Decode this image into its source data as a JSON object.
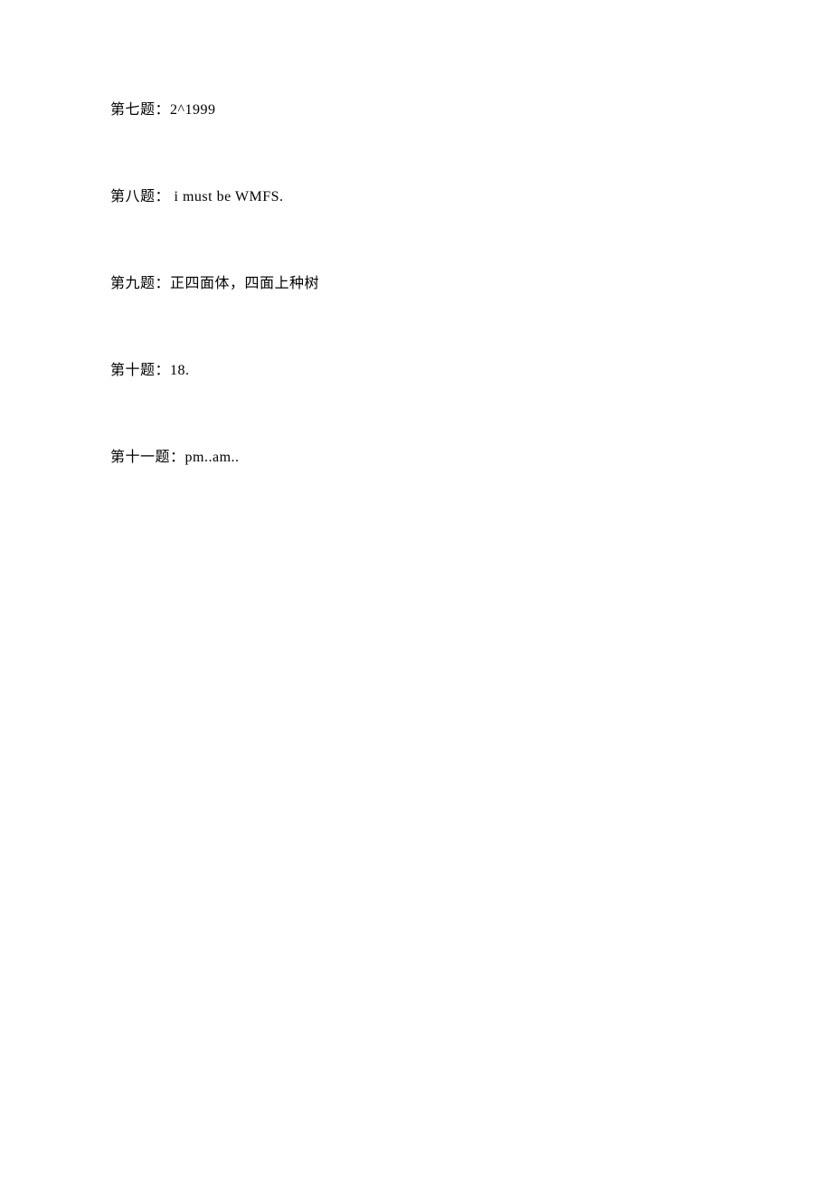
{
  "questions": [
    {
      "label": "第七题：",
      "answer": "2^1999"
    },
    {
      "label": "第八题：",
      "answer": " i must be WMFS."
    },
    {
      "label": "第九题：",
      "answer": "正四面体，四面上种树"
    },
    {
      "label": "第十题：",
      "answer": "18."
    },
    {
      "label": "第十一题：",
      "answer": "pm..am.."
    }
  ]
}
